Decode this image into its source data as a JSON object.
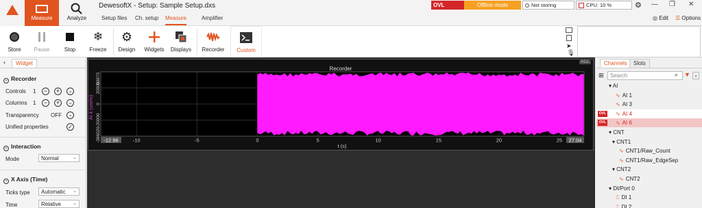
{
  "app": {
    "title": "DewesoftX - Setup: Sample Setup.dxs",
    "measure_label": "Measure",
    "analyze_label": "Analyze",
    "tabs": [
      "Setup files",
      "Ch. setup",
      "Measure",
      "Amplifier"
    ]
  },
  "status": {
    "ovl": "OVL",
    "mode": "Offline mode",
    "storing": "Not storing",
    "cpu": "CPU: 10 %",
    "edit": "Edit",
    "options": "Options"
  },
  "toolbar": {
    "store": "Store",
    "pause": "Pause",
    "stop": "Stop",
    "freeze": "Freeze",
    "design": "Design",
    "widgets": "Widgets",
    "displays": "Displays",
    "recorder": "Recorder",
    "custom": "Custom"
  },
  "left": {
    "tab": "Widget",
    "recorder_section": "Recorder",
    "controls_label": "Controls",
    "controls_value": "1",
    "columns_label": "Columns",
    "columns_value": "1",
    "transparency_label": "Transparency",
    "transparency_value": "OFF",
    "unified_label": "Unified properties",
    "interaction_section": "Interaction",
    "mode_label": "Mode",
    "mode_value": "Normal",
    "xaxis_section": "X Axis (Time)",
    "ticks_label": "Ticks type",
    "ticks_value": "Automatic",
    "time_label": "Time",
    "time_value": "Relative"
  },
  "recorder": {
    "title": "Recorder",
    "rdc": "RDC",
    "ylabel": "AI 4 (um/m)",
    "y_ticks": [
      "53873",
      "20000",
      "0",
      "-20000",
      "-386020"
    ],
    "x_start": "-12.96",
    "x_end": "27.04",
    "x_ticks": [
      "-10",
      "-5",
      "0",
      "5",
      "10",
      "15",
      "20",
      "25"
    ],
    "xlabel": "t (s)"
  },
  "chart_data": {
    "type": "area",
    "title": "Recorder",
    "xlabel": "t (s)",
    "ylabel": "AI 4 (um/m)",
    "xlim": [
      -12.96,
      27.04
    ],
    "ylim": [
      -386020,
      53873
    ],
    "data_start": 0,
    "color": "#ff1aff",
    "grid": true
  },
  "right": {
    "tab_channels": "Channels",
    "tab_slots": "Slots",
    "search_placeholder": "Search",
    "tree": [
      {
        "label": "AI",
        "indent": 0,
        "kind": "group"
      },
      {
        "label": "AI 1",
        "indent": 2,
        "kind": "ch"
      },
      {
        "label": "AI 3",
        "indent": 2,
        "kind": "ch"
      },
      {
        "label": "AI 4",
        "indent": 2,
        "kind": "ovl-sel"
      },
      {
        "label": "AI 6",
        "indent": 2,
        "kind": "ovl-sel2"
      },
      {
        "label": "CNT",
        "indent": 0,
        "kind": "group"
      },
      {
        "label": "CNT1",
        "indent": 1,
        "kind": "group"
      },
      {
        "label": "CNT1/Raw_Count",
        "indent": 3,
        "kind": "ch"
      },
      {
        "label": "CNT1/Raw_EdgeSep",
        "indent": 3,
        "kind": "ch"
      },
      {
        "label": "CNT2",
        "indent": 1,
        "kind": "group"
      },
      {
        "label": "CNT2",
        "indent": 3,
        "kind": "ch"
      },
      {
        "label": "DI/Port 0",
        "indent": 0,
        "kind": "group"
      },
      {
        "label": "DI 1",
        "indent": 2,
        "kind": "di"
      },
      {
        "label": "DI 2",
        "indent": 2,
        "kind": "di"
      }
    ]
  }
}
